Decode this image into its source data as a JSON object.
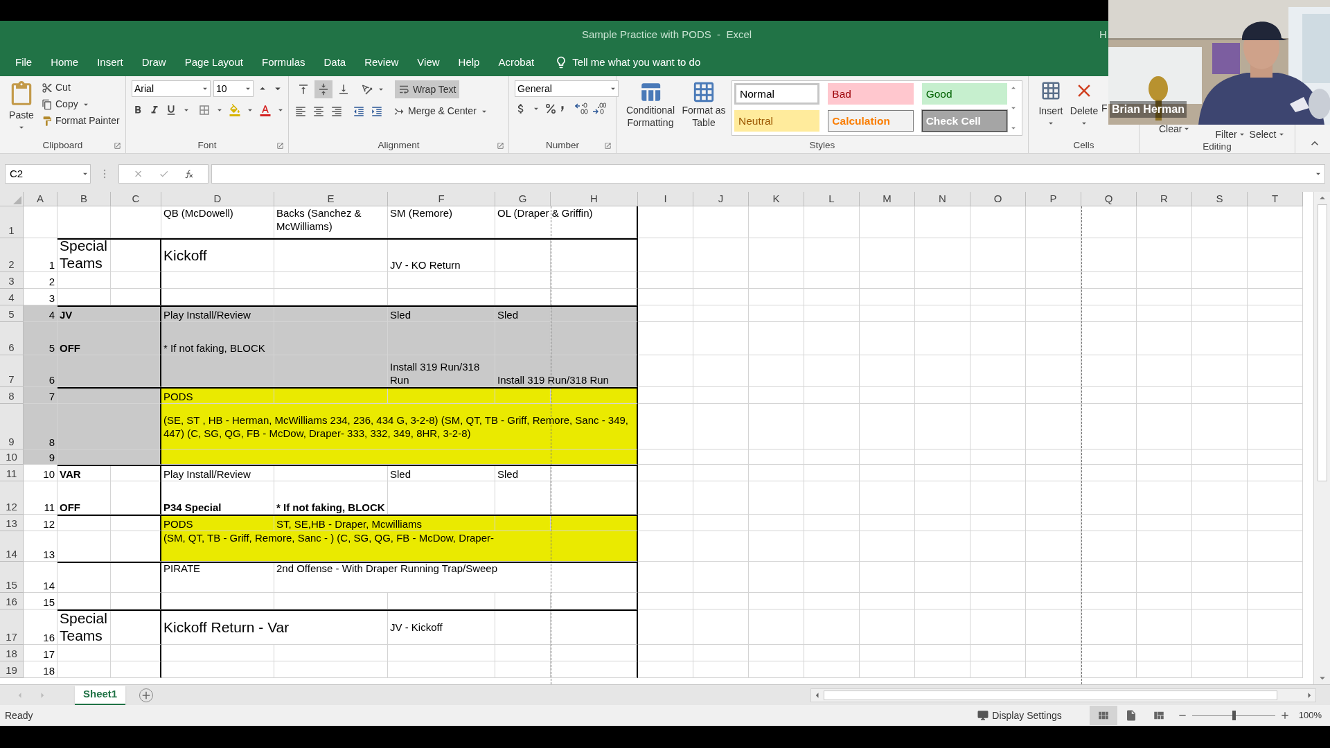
{
  "title": "Sample Practice with PODS  -  Excel",
  "account": "H",
  "tabs": [
    {
      "label": "File"
    },
    {
      "label": "Home"
    },
    {
      "label": "Insert"
    },
    {
      "label": "Draw"
    },
    {
      "label": "Page Layout"
    },
    {
      "label": "Formulas"
    },
    {
      "label": "Data"
    },
    {
      "label": "Review"
    },
    {
      "label": "View"
    },
    {
      "label": "Help"
    },
    {
      "label": "Acrobat"
    }
  ],
  "tell_me": "Tell me what you want to do",
  "clipboard": {
    "paste": "Paste",
    "cut": "Cut",
    "copy": "Copy",
    "format_painter": "Format Painter",
    "label": "Clipboard"
  },
  "font": {
    "name": "Arial",
    "size": "10",
    "label": "Font"
  },
  "alignment": {
    "vertical": [
      {
        "kind": "top",
        "selected": false
      },
      {
        "kind": "middle",
        "selected": true
      },
      {
        "kind": "bottom",
        "selected": false
      }
    ],
    "wrap_text": "Wrap Text",
    "wrap_on": true,
    "merge": "Merge & Center",
    "label": "Alignment"
  },
  "number": {
    "format": "General",
    "label": "Number"
  },
  "styles": {
    "conditional": "Conditional Formatting",
    "format_table": "Format as Table",
    "items": [
      {
        "label": "Normal",
        "kind": "normal",
        "selected": true
      },
      {
        "label": "Bad",
        "kind": "bad",
        "selected": false
      },
      {
        "label": "Good",
        "kind": "good",
        "selected": false
      },
      {
        "label": "Neutral",
        "kind": "neutral",
        "selected": false
      },
      {
        "label": "Calculation",
        "kind": "calculation",
        "selected": false
      },
      {
        "label": "Check Cell",
        "kind": "check",
        "selected": false
      }
    ],
    "label": "Styles"
  },
  "cells_group": {
    "insert": "Insert",
    "delete": "Delete",
    "format": "F",
    "label": "Cells"
  },
  "editing": {
    "clear": "Clear",
    "filter": "Filter",
    "select": "Select",
    "label": "Editing"
  },
  "name_box": "C2",
  "columns": [
    "A",
    "B",
    "C",
    "D",
    "E",
    "F",
    "G",
    "H",
    "I",
    "J",
    "K",
    "L",
    "M",
    "N",
    "O",
    "P",
    "Q",
    "R",
    "S",
    "T"
  ],
  "rows": [
    {
      "number": "1",
      "cells": [
        {},
        {},
        {},
        {
          "text": "QB (McDowell)"
        },
        {
          "text": "Backs (Sanchez & McWilliams)"
        },
        {
          "text": "SM (Remore)"
        },
        {
          "text": "OL (Draper & Griffin)"
        }
      ]
    },
    {
      "number": "2",
      "rule_above": true,
      "cells": [
        {
          "text": "1",
          "kind": "number"
        },
        {
          "text": "Special Teams",
          "kind": "heading"
        },
        {},
        {
          "text": "Kickoff",
          "kind": "heading"
        },
        {},
        {
          "text": "JV - KO Return"
        }
      ]
    },
    {
      "number": "3",
      "cells": [
        {
          "text": "2",
          "kind": "number"
        }
      ]
    },
    {
      "number": "4",
      "cells": [
        {
          "text": "3",
          "kind": "number"
        }
      ]
    },
    {
      "number": "5",
      "rule_above": true,
      "cells": [
        {
          "text": "4",
          "kind": "number",
          "color": "#c9c9c9"
        },
        {
          "text": "JV",
          "kind": "label",
          "color": "#c9c9c9"
        },
        {
          "text": "Play Install/Review",
          "color": "#c9c9c9"
        },
        {
          "color": "#c9c9c9"
        },
        {
          "text": "Sled",
          "color": "#c9c9c9"
        },
        {
          "text": "Sled",
          "color": "#c9c9c9"
        },
        {
          "color": "#c9c9c9"
        }
      ]
    },
    {
      "number": "6",
      "cells": [
        {
          "text": "5",
          "kind": "number",
          "color": "#c9c9c9"
        },
        {
          "text": "OFF",
          "kind": "label",
          "color": "#c9c9c9"
        },
        {
          "text": "* If not faking, BLOCK",
          "color": "#c9c9c9"
        },
        {
          "color": "#c9c9c9"
        },
        {
          "color": "#c9c9c9"
        },
        {
          "color": "#c9c9c9"
        },
        {
          "color": "#c9c9c9"
        }
      ]
    },
    {
      "number": "7",
      "cells": [
        {
          "text": "6",
          "kind": "number",
          "color": "#c9c9c9"
        },
        {
          "color": "#c9c9c9"
        },
        {
          "color": "#c9c9c9"
        },
        {
          "color": "#c9c9c9"
        },
        {
          "text": "Install 319 Run/318 Run",
          "color": "#c9c9c9"
        },
        {
          "text": "Install 319 Run/318 Run",
          "color": "#c9c9c9"
        }
      ]
    },
    {
      "number": "8",
      "rule_above": true,
      "cells": [
        {
          "text": "7",
          "kind": "number",
          "color": "#c9c9c9"
        },
        {
          "color": "#c9c9c9"
        },
        {
          "text": "PODS",
          "color": "#eaea00"
        },
        {
          "color": "#eaea00"
        },
        {
          "color": "#eaea00"
        },
        {
          "color": "#eaea00"
        },
        {
          "color": "#eaea00"
        }
      ]
    },
    {
      "number": "9",
      "cells": [
        {
          "text": "8",
          "kind": "number",
          "color": "#c9c9c9"
        },
        {
          "color": "#c9c9c9"
        },
        {
          "text": "(SE, ST , HB - Herman, McWilliams 234, 236, 434 G, 3-2-8) (SM, QT, TB - Griff, Remore, Sanc - 349, 447) (C, SG, QG, FB - McDow, Draper- 333, 332, 349, 8HR, 3-2-8)",
          "color": "#eaea00"
        }
      ]
    },
    {
      "number": "10",
      "cells": [
        {
          "text": "9",
          "kind": "number",
          "color": "#c9c9c9"
        },
        {
          "color": "#c9c9c9"
        },
        {
          "color": "#eaea00"
        }
      ]
    },
    {
      "number": "11",
      "rule_above": true,
      "cells": [
        {
          "text": "10",
          "kind": "number"
        },
        {
          "text": "VAR",
          "kind": "label"
        },
        {},
        {
          "text": "Play Install/Review"
        },
        {},
        {
          "text": "Sled"
        },
        {
          "text": "Sled"
        }
      ]
    },
    {
      "number": "12",
      "cells": [
        {
          "text": "11",
          "kind": "number"
        },
        {
          "text": "OFF",
          "kind": "label"
        },
        {},
        {
          "text": "P34 Special",
          "kind": "label"
        },
        {
          "text": "* If not faking, BLOCK",
          "kind": "label"
        }
      ]
    },
    {
      "number": "13",
      "rule_above": true,
      "cells": [
        {
          "text": "12",
          "kind": "number"
        },
        {},
        {},
        {
          "text": "PODS",
          "color": "#eaea00"
        },
        {
          "text": "ST, SE,HB - Draper, Mcwilliams",
          "color": "#eaea00"
        },
        {
          "color": "#eaea00"
        },
        {
          "color": "#eaea00"
        }
      ]
    },
    {
      "number": "14",
      "cells": [
        {
          "text": "13",
          "kind": "number"
        },
        {},
        {},
        {
          "text": "(SM, QT, TB - Griff, Remore, Sanc - ) (C, SG, QG, FB - McDow, Draper-",
          "color": "#eaea00"
        }
      ]
    },
    {
      "number": "15",
      "rule_above": true,
      "cells": [
        {
          "text": "14",
          "kind": "number"
        },
        {},
        {},
        {
          "text": "PIRATE"
        },
        {
          "text": "2nd Offense - With Draper Running Trap/Sweep"
        }
      ]
    },
    {
      "number": "16",
      "cells": [
        {
          "text": "15",
          "kind": "number"
        }
      ]
    },
    {
      "number": "17",
      "rule_above": true,
      "cells": [
        {
          "text": "16",
          "kind": "number"
        },
        {
          "text": "Special Teams",
          "kind": "heading"
        },
        {},
        {
          "text": "Kickoff Return - Var",
          "kind": "heading"
        },
        {
          "text": "JV - Kickoff"
        }
      ]
    },
    {
      "number": "18",
      "cells": [
        {
          "text": "17",
          "kind": "number"
        }
      ]
    },
    {
      "number": "19",
      "cells": [
        {
          "text": "18",
          "kind": "number"
        }
      ]
    }
  ],
  "sheets": [
    {
      "label": "Sheet1",
      "selected": true
    }
  ],
  "status": {
    "text": "Ready",
    "display_settings": "Display Settings",
    "views": [
      {
        "kind": "normal",
        "selected": true
      },
      {
        "kind": "page_layout",
        "selected": false
      },
      {
        "kind": "page_break",
        "selected": false
      }
    ],
    "zoom": {
      "level": 0.5,
      "reading": "100%"
    }
  },
  "video": {
    "name": "Brian Herman"
  }
}
